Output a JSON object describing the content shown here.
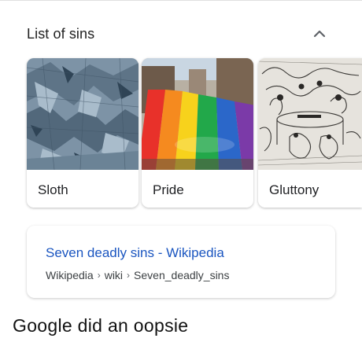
{
  "list": {
    "title": "List of sins",
    "collapse_icon": "chevron-up-icon"
  },
  "cards": [
    {
      "label": "Sloth",
      "image": "blue-gray-engraving-thumbnail"
    },
    {
      "label": "Pride",
      "image": "rainbow-flag-parade-thumbnail"
    },
    {
      "label": "Gluttony",
      "image": "black-and-white-woodcut-thumbnail"
    }
  ],
  "result": {
    "title": "Seven deadly sins - Wikipedia",
    "breadcrumb": [
      "Wikipedia",
      "wiki",
      "Seven_deadly_sins"
    ],
    "separator": "›",
    "link_color": "#1a55c0"
  },
  "caption": "Google did an oopsie"
}
